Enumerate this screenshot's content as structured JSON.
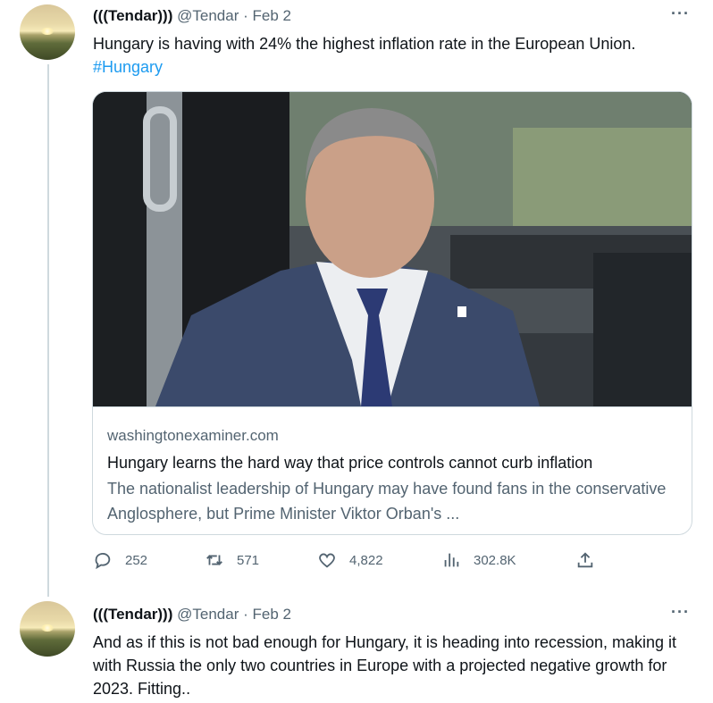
{
  "tweets": [
    {
      "display_name": "(((Tendar)))",
      "handle": "@Tendar",
      "separator": "·",
      "date": "Feb 2",
      "text": "Hungary is having with 24% the highest inflation rate in the European Union.",
      "hashtag": "#Hungary",
      "card": {
        "domain": "washingtonexaminer.com",
        "title": "Hungary learns the hard way that price controls cannot curb inflation",
        "description": "The nationalist leadership of Hungary may have found fans in the conservative Anglosphere, but Prime Minister Viktor Orban's ..."
      },
      "actions": {
        "replies": "252",
        "retweets": "571",
        "likes": "4,822",
        "views": "302.8K"
      }
    },
    {
      "display_name": "(((Tendar)))",
      "handle": "@Tendar",
      "separator": "·",
      "date": "Feb 2",
      "text": "And as if this is not bad enough for Hungary, it is heading into recession, making it with Russia the only two countries in Europe with a projected negative growth for 2023. Fitting.."
    }
  ],
  "more_icon": "···",
  "icons": [
    "reply-icon",
    "retweet-icon",
    "like-icon",
    "views-icon",
    "share-icon",
    "more-icon"
  ],
  "colors": {
    "link": "#1d9bf0",
    "secondary_text": "#536471",
    "border": "#cfd9de"
  }
}
